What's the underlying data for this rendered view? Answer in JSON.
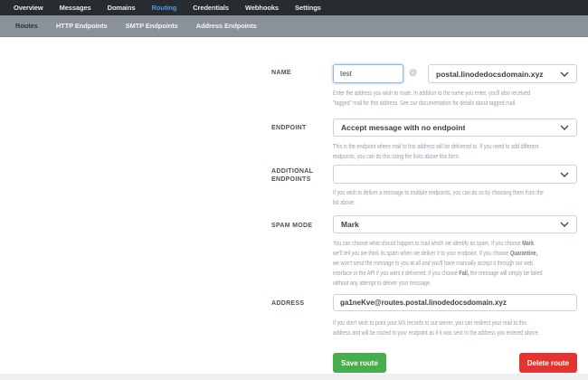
{
  "topnav": {
    "items": [
      {
        "label": "Overview",
        "active": false
      },
      {
        "label": "Messages",
        "active": false
      },
      {
        "label": "Domains",
        "active": false
      },
      {
        "label": "Routing",
        "active": true
      },
      {
        "label": "Credentials",
        "active": false
      },
      {
        "label": "Webhooks",
        "active": false
      },
      {
        "label": "Settings",
        "active": false
      }
    ]
  },
  "subnav": {
    "items": [
      {
        "label": "Routes",
        "active": true
      },
      {
        "label": "HTTP Endpoints",
        "active": false
      },
      {
        "label": "SMTP Endpoints",
        "active": false
      },
      {
        "label": "Address Endpoints",
        "active": false
      }
    ]
  },
  "form": {
    "name": {
      "label": "NAME",
      "value": "test",
      "at": "@",
      "domain": "postal.linodedocsdomain.xyz",
      "help": "Enter the address you wish to route. In addition to the name you enter, you'll also received\n\"tagged\" mail for this address. See our documentation for details about tagged mail."
    },
    "endpoint": {
      "label": "ENDPOINT",
      "value": "Accept message with no endpoint",
      "help": "This is the endpoint where mail to this address will be delivered to. If you need to add different\nendpoints, you can do this using the links above this form."
    },
    "additional_endpoints": {
      "label": "ADDITIONAL ENDPOINTS",
      "value": "",
      "help": "If you wish to deliver a message to multiple endpoints, you can do so by choosing them from the\nlist above."
    },
    "spam_mode": {
      "label": "SPAM MODE",
      "value": "Mark",
      "help_segments": [
        {
          "text": "You can choose what should happen to mail which we identify as spam. If you choose ",
          "bold": false
        },
        {
          "text": "Mark",
          "bold": true
        },
        {
          "text": "\nwe'll tell you we think its spam when we deliver it to your endpoint. If you choose ",
          "bold": false
        },
        {
          "text": "Quarantine,",
          "bold": true
        },
        {
          "text": "\nwe won't send the message to you at all and you'll have manually accept it through our web\ninterface or the API if you want it delivered. If you choose ",
          "bold": false
        },
        {
          "text": "Fail,",
          "bold": true
        },
        {
          "text": " the message will simply be failed\nwithout any attempt to deliver your message.",
          "bold": false
        }
      ]
    },
    "address": {
      "label": "ADDRESS",
      "value": "ga1neKve@routes.postal.linodedocsdomain.xyz",
      "help": "If you don't wish to point your MX records to our server, you can redirect your mail to this\naddress and will be routed to your endpoint as if it was sent to the address you entered above."
    },
    "buttons": {
      "save": "Save route",
      "delete": "Delete route"
    }
  },
  "colors": {
    "topnav_bg": "#282c31",
    "active_link_blue": "#4e9add",
    "subnav_bg": "#8a9199",
    "save_green": "#48ad4d",
    "delete_red": "#e23532"
  }
}
